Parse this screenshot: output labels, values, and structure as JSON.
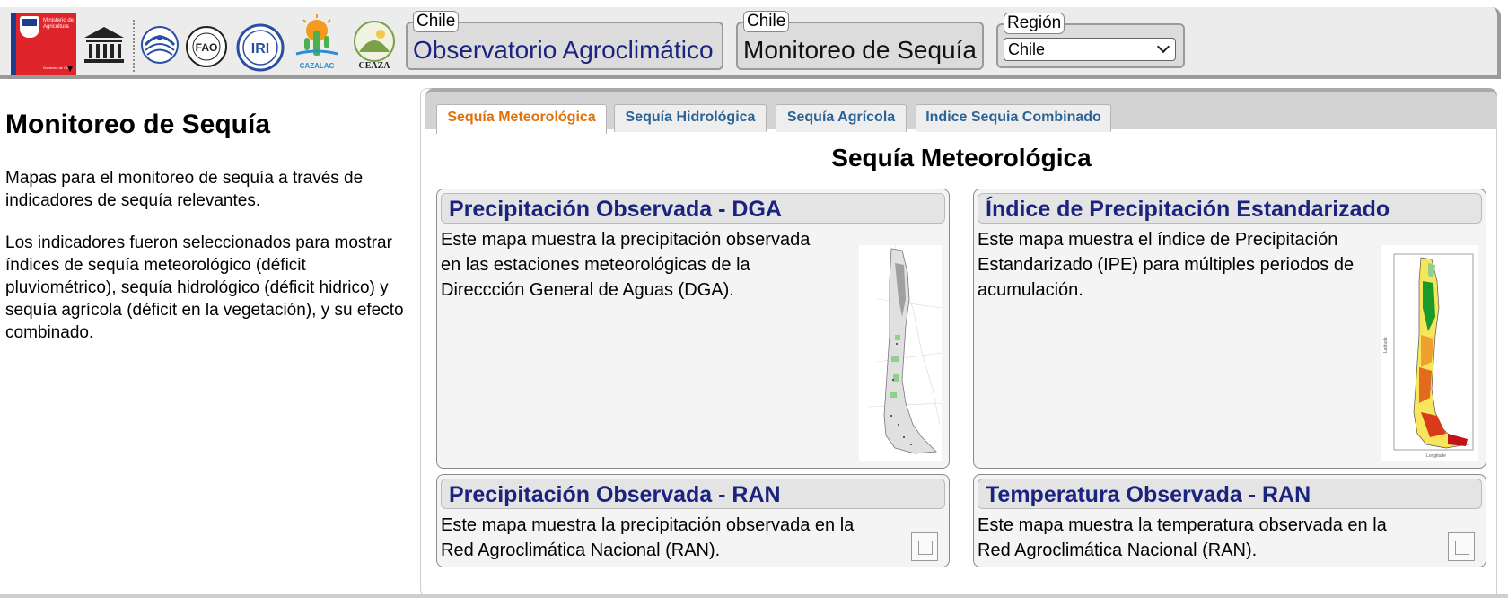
{
  "header": {
    "ministry_logo_text": "Ministerio de Agricultura",
    "ministry_logo_sub": "Gobierno de Chile",
    "logo_cazalac_text": "CAZALAC",
    "logo_ceaza_text": "CEAZA",
    "logo_iri_text": "IRI",
    "observatorio": {
      "legend": "Chile",
      "title": "Observatorio Agroclimático"
    },
    "monitoreo": {
      "legend": "Chile",
      "title": "Monitoreo de Sequía"
    },
    "region": {
      "legend": "Región",
      "selected": "Chile"
    }
  },
  "left": {
    "title": "Monitoreo de Sequía",
    "p1": "Mapas para el monitoreo de sequía a través de indicadores de sequía relevantes.",
    "p2": "Los indicadores fueron seleccionados para mostrar índices de sequía meteorológico (déficit pluviométrico), sequía hidrológico (déficit hidrico) y sequía agrícola (déficit en la vegetación), y su efecto combinado."
  },
  "tabs": [
    {
      "label": "Sequía Meteorológica",
      "active": true
    },
    {
      "label": "Sequía Hidrológica",
      "active": false
    },
    {
      "label": "Sequía Agrícola",
      "active": false
    },
    {
      "label": "Indice Sequia Combinado",
      "active": false
    }
  ],
  "section_title": "Sequía Meteorológica",
  "cards": [
    {
      "title": "Precipitación Observada - DGA",
      "desc": [
        "Este mapa muestra la precipitación observada",
        "en las estaciones meteorológicas de la",
        "Direccción General de Aguas (DGA)."
      ]
    },
    {
      "title": "Índice de Precipitación Estandarizado",
      "desc": [
        "Este mapa muestra el índice de Precipitación",
        "Estandarizado (IPE) para múltiples periodos de",
        "acumulación."
      ]
    },
    {
      "title": "Precipitación Observada - RAN",
      "desc": [
        "Este mapa muestra la precipitación observada en la",
        "Red Agroclimática Nacional (RAN)."
      ]
    },
    {
      "title": "Temperatura Observada - RAN",
      "desc": [
        "Este mapa muestra la temperatura observada en la",
        "Red Agroclimática Nacional (RAN)."
      ]
    }
  ],
  "colors": {
    "tab_active": "#e17009",
    "tab_inactive": "#2c6396",
    "card_title": "#1a237e",
    "observatorio_title": "#1a237e"
  }
}
